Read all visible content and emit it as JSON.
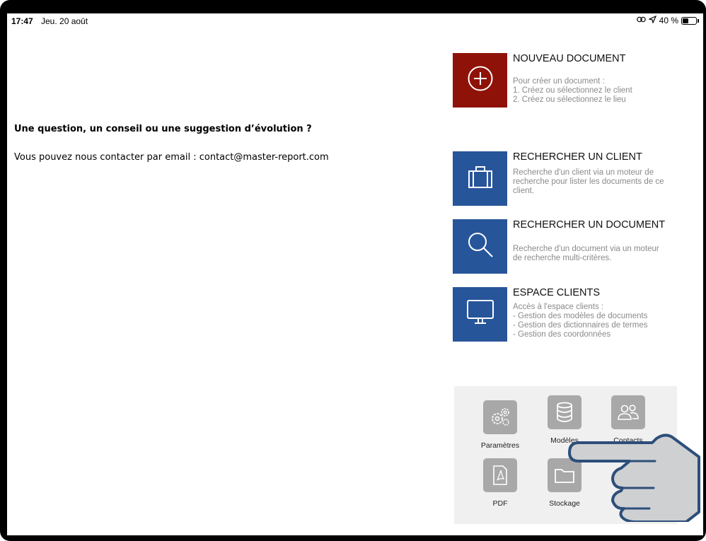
{
  "status_bar": {
    "time": "17:47",
    "date": "Jeu. 20 août",
    "battery": "40 %"
  },
  "contact": {
    "question": "Une question, un conseil ou une suggestion d’évolution ?",
    "line": "Vous pouvez nous contacter par email : contact@master-report.com"
  },
  "actions": {
    "new_document": {
      "title": "NOUVEAU DOCUMENT",
      "desc": [
        "Pour créer un document :",
        "1. Créez ou sélectionnez le client",
        "2. Créez ou sélectionnez le lieu"
      ],
      "icon": "plus-circle-icon",
      "color": "#8f1208"
    },
    "search_client": {
      "title": "RECHERCHER UN CLIENT",
      "desc": [
        "Recherche d'un client via un moteur de",
        "recherche pour lister les documents de ce",
        "client."
      ],
      "icon": "briefcase-icon",
      "color": "#27559a"
    },
    "search_document": {
      "title": "RECHERCHER UN DOCUMENT",
      "desc": [
        "Recherche d'un document via un moteur",
        "de recherche multi-critères."
      ],
      "icon": "magnifier-icon",
      "color": "#27559a"
    },
    "client_space": {
      "title": "ESPACE CLIENTS",
      "desc": [
        "Accès à l'espace clients :",
        "- Gestion des modèles de documents",
        "- Gestion des dictionnaires de termes",
        "- Gestion des coordonnées"
      ],
      "icon": "monitor-icon",
      "color": "#27559a"
    }
  },
  "tools": {
    "parametres": "Paramètres",
    "modeles": "Modèles",
    "contacts": "Contacts",
    "pdf": "PDF",
    "stockage": "Stockage"
  }
}
